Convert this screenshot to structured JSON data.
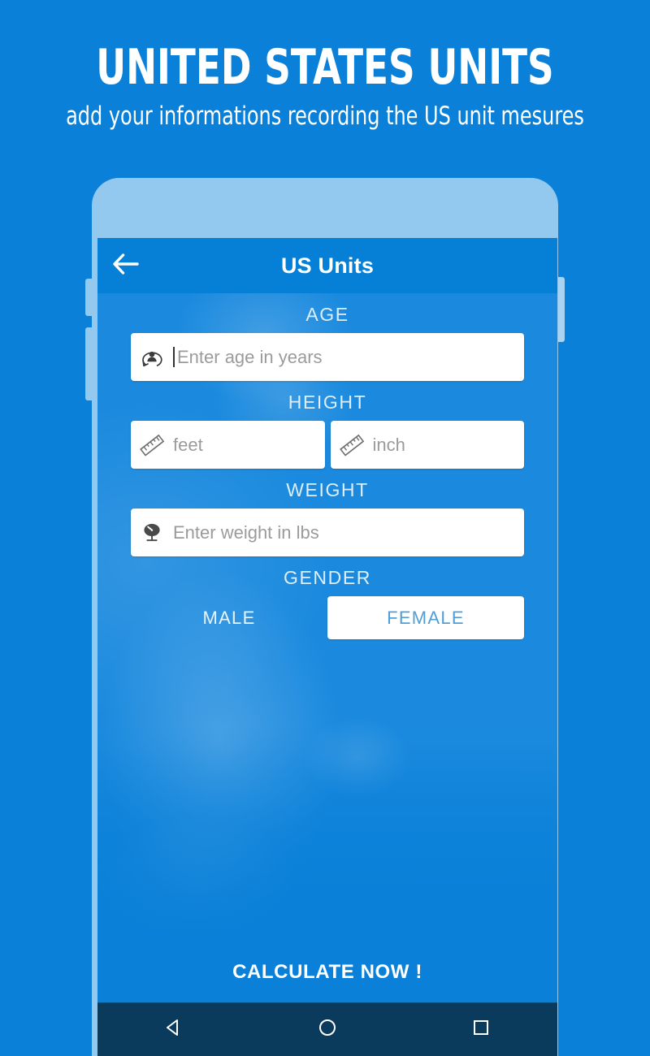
{
  "promo": {
    "title": "UNITED STATES UNITS",
    "subtitle": "add your informations recording the US unit mesures"
  },
  "app": {
    "back_icon": "arrow-left-icon",
    "title": "US Units"
  },
  "form": {
    "age": {
      "label": "AGE",
      "icon": "person-age-icon",
      "placeholder": "Enter age in years",
      "value": ""
    },
    "height": {
      "label": "HEIGHT",
      "feet": {
        "icon": "ruler-icon",
        "placeholder": "feet",
        "value": ""
      },
      "inch": {
        "icon": "ruler-icon",
        "placeholder": "inch",
        "value": ""
      }
    },
    "weight": {
      "label": "WEIGHT",
      "icon": "scale-icon",
      "placeholder": "Enter weight in lbs",
      "value": ""
    },
    "gender": {
      "label": "GENDER",
      "options": [
        {
          "label": "MALE",
          "selected": false
        },
        {
          "label": "FEMALE",
          "selected": true
        }
      ]
    }
  },
  "actions": {
    "calculate": "CALCULATE NOW !"
  },
  "navbar": {
    "back": "triangle-back-icon",
    "home": "circle-home-icon",
    "recents": "square-recents-icon"
  },
  "colors": {
    "background_blue": "#0a80d8",
    "appbar_blue": "#0580d6",
    "bezel_blue": "#93c9ef",
    "navbar_navy": "#0a3a5c",
    "selected_text": "#4f9ed6",
    "placeholder_grey": "#9b9b9b"
  }
}
